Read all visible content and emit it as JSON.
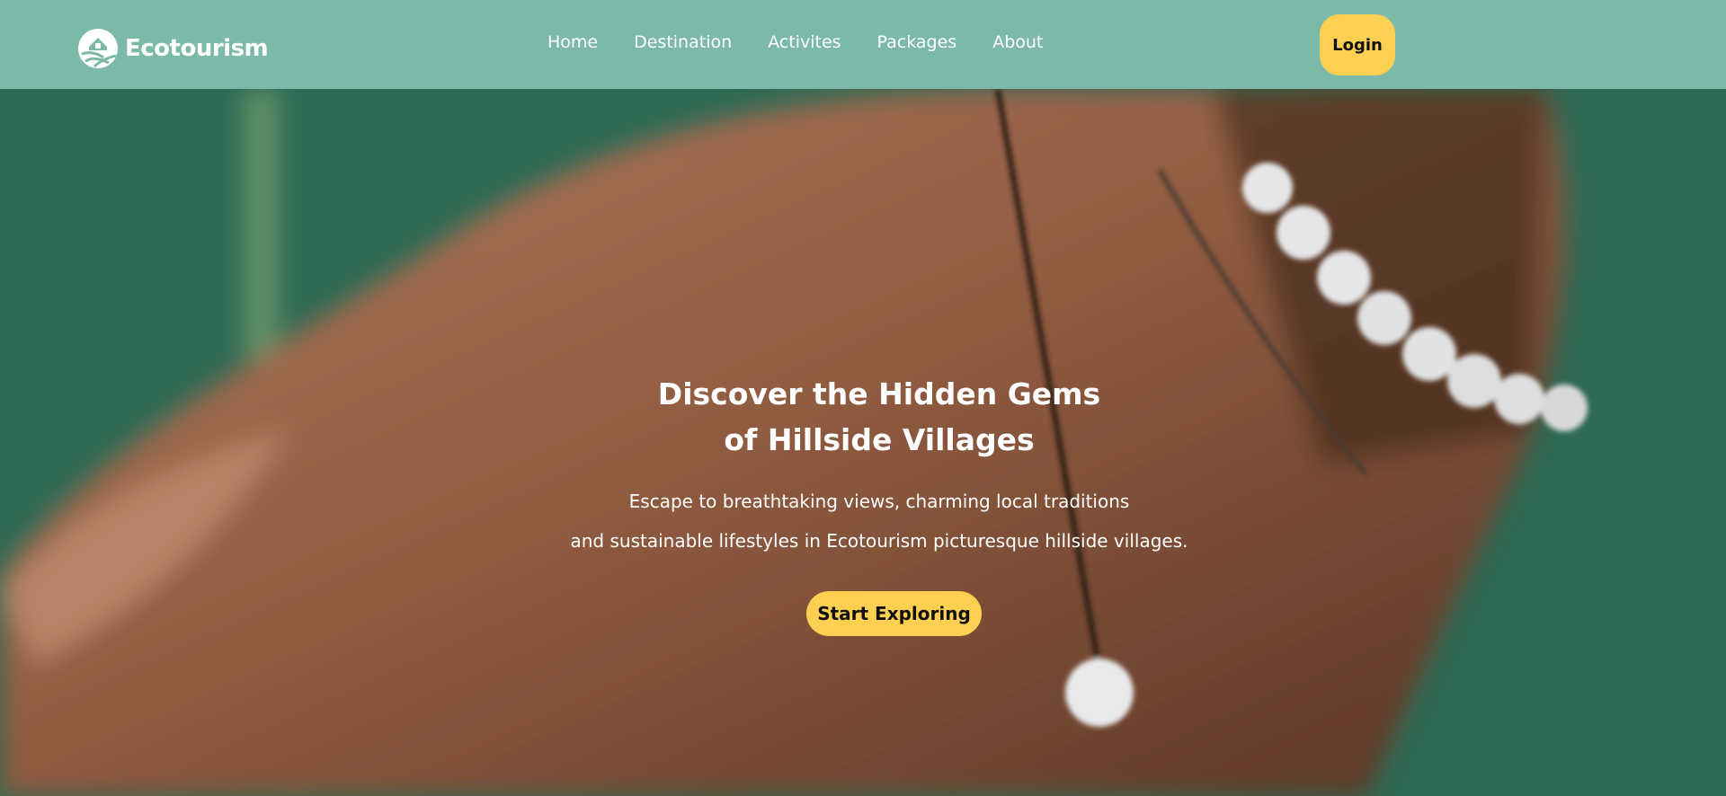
{
  "brand": {
    "name": "Ecotourism",
    "logo_icon": "farmhouse-leaf-icon"
  },
  "nav": {
    "items": [
      {
        "label": "Home"
      },
      {
        "label": "Destination"
      },
      {
        "label": "Activites"
      },
      {
        "label": "Packages"
      },
      {
        "label": "About"
      }
    ],
    "login_label": "Login"
  },
  "hero": {
    "title_line1": "Discover the Hidden Gems",
    "title_line2": "of Hillside Villages",
    "subtitle_line1": "Escape to breathtaking views, charming local traditions",
    "subtitle_line2": "and sustainable lifestyles in Ecotourism picturesque hillside villages.",
    "cta_label": "Start Exploring",
    "background_image": "close-up-hand-with-bead-bracelet-photo"
  },
  "colors": {
    "navbar": "#7cb9a8",
    "accent": "#fdd052",
    "hero_text": "#ffffff"
  }
}
